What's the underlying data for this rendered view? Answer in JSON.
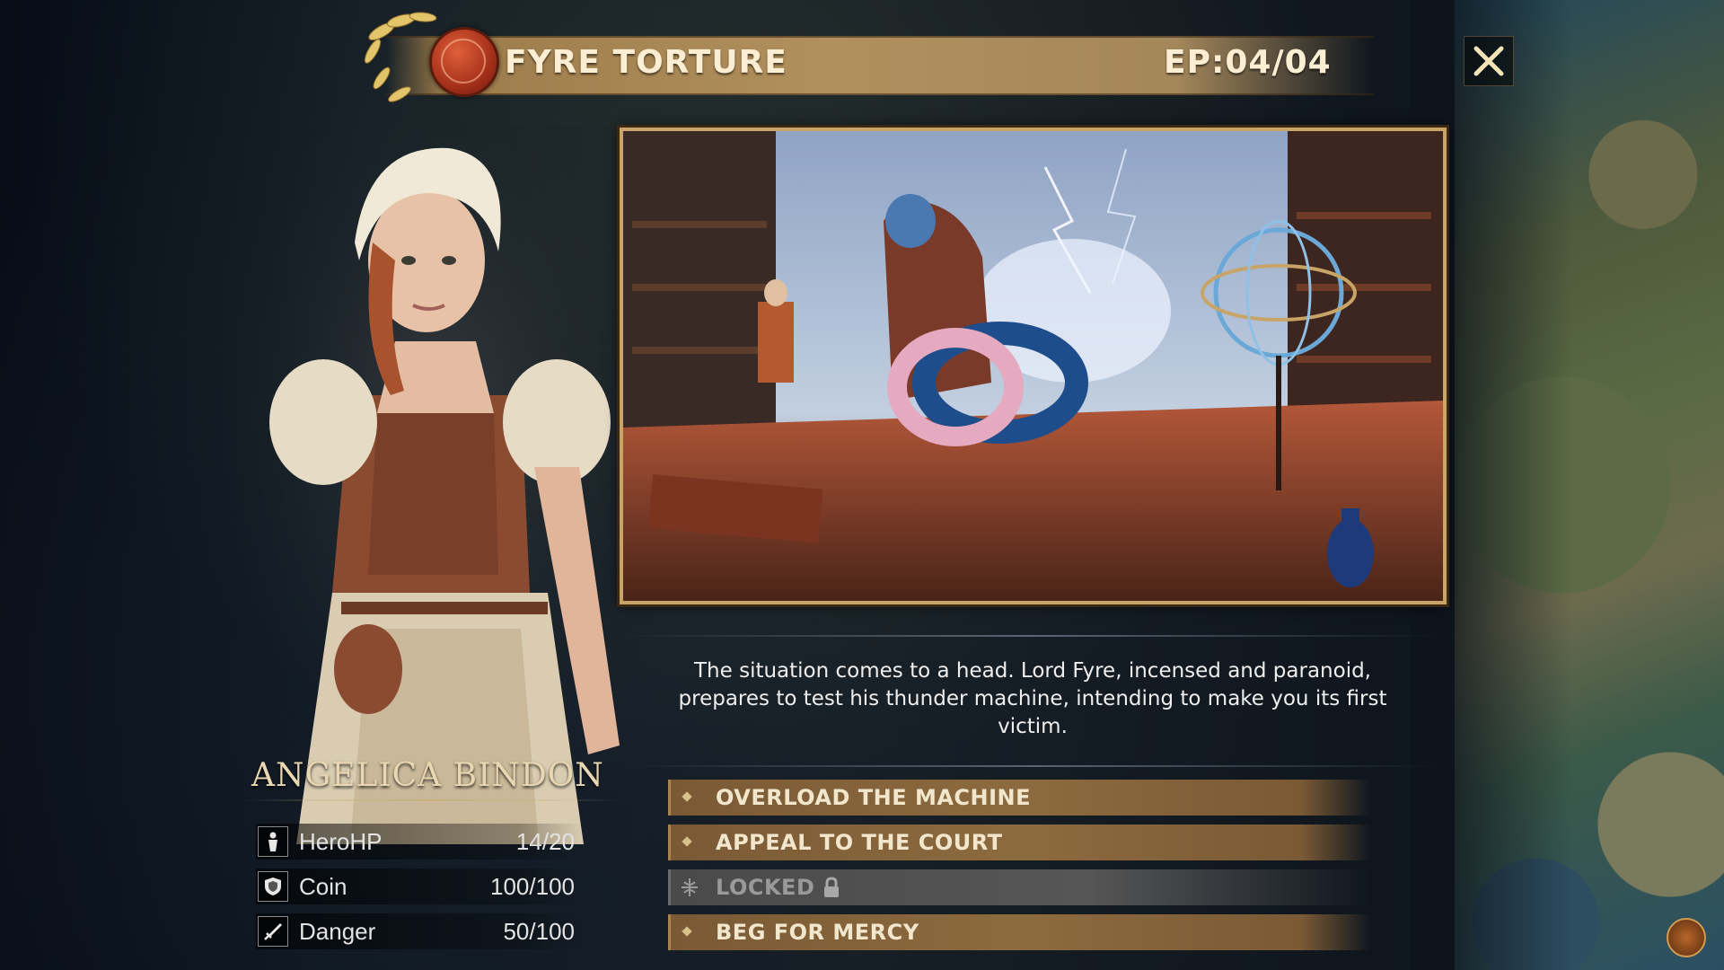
{
  "event": {
    "title": "FYRE TORTURE",
    "episode": "EP:04/04"
  },
  "character": {
    "name": "ANGELICA BINDON",
    "stats": [
      {
        "label": "HeroHP",
        "value": "14/20",
        "icon": "hero-figure-icon"
      },
      {
        "label": "Coin",
        "value": "100/100",
        "icon": "shield-coin-icon"
      },
      {
        "label": "Danger",
        "value": "50/100",
        "icon": "dagger-icon"
      }
    ]
  },
  "narrative": {
    "text": "The situation comes to a head. Lord Fyre, incensed and paranoid, prepares to test his thunder machine, intending to make you its first victim."
  },
  "choices": [
    {
      "label": "OVERLOAD THE MACHINE",
      "locked": false
    },
    {
      "label": "APPEAL TO THE COURT",
      "locked": false
    },
    {
      "label": "LOCKED",
      "locked": true
    },
    {
      "label": "BEG FOR MERCY",
      "locked": false
    }
  ],
  "icons": {
    "close": "close-x-icon",
    "seal": "fyre-seal-icon",
    "lock": "padlock-icon",
    "map_emblem": "faction-emblem-icon"
  },
  "colors": {
    "banner": "#b0905d",
    "frame_gold": "#c9a467",
    "choice_bg": "#8d6b40",
    "locked_bg": "#565656",
    "seal_red": "#a5301a"
  }
}
